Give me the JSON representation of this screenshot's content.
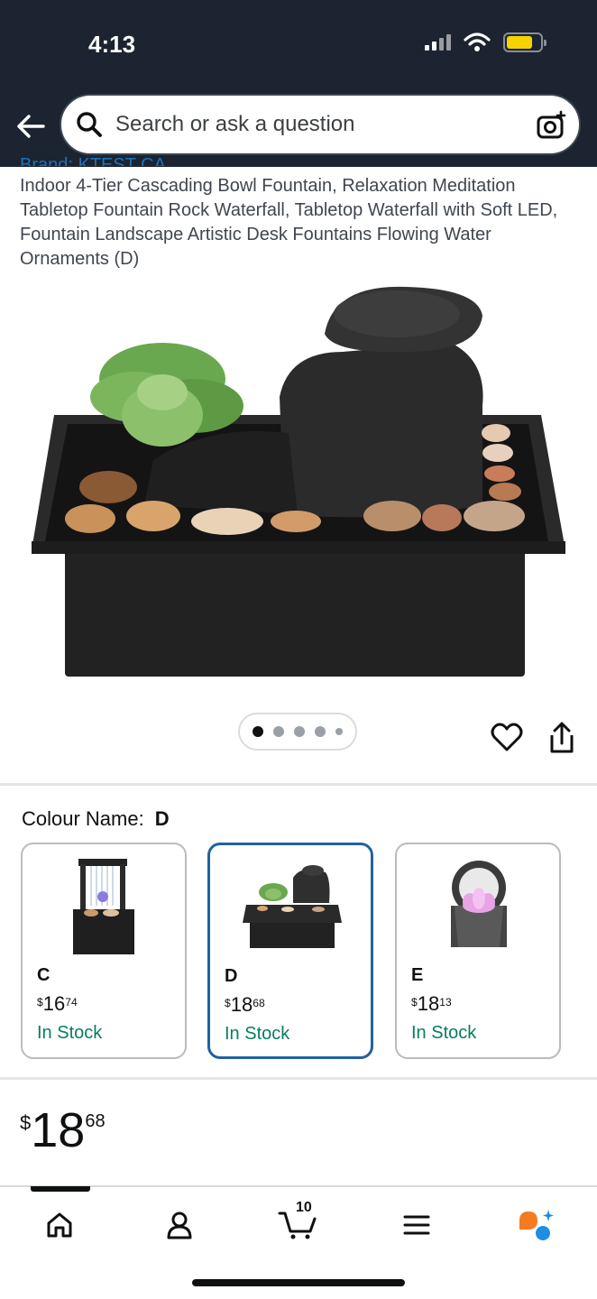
{
  "status_bar": {
    "time": "4:13"
  },
  "search": {
    "placeholder": "Search or ask a question"
  },
  "product": {
    "brand_partial": "Brand: KTEST CA",
    "title": "Indoor 4-Tier Cascading Bowl Fountain, Relaxation Meditation Tabletop Fountain Rock Waterfall, Tabletop Waterfall with Soft LED, Fountain Landscape Artistic Desk Fountains Flowing Water Ornaments (D)",
    "image_count": 5,
    "active_image": 1
  },
  "colour": {
    "label": "Colour Name:",
    "selected": "D",
    "options": [
      {
        "name": "C",
        "currency": "$",
        "dollars": "16",
        "cents": "74",
        "stock": "In Stock",
        "selected": false
      },
      {
        "name": "D",
        "currency": "$",
        "dollars": "18",
        "cents": "68",
        "stock": "In Stock",
        "selected": true
      },
      {
        "name": "E",
        "currency": "$",
        "dollars": "18",
        "cents": "13",
        "stock": "In Stock",
        "selected": false
      }
    ]
  },
  "price": {
    "currency": "$",
    "dollars": "18",
    "cents": "68"
  },
  "bottom_nav": {
    "cart_count": "10",
    "items": [
      "home-icon",
      "account-icon",
      "cart-icon",
      "menu-icon",
      "rufus-icon"
    ]
  },
  "colors": {
    "header_bg": "#1b2430",
    "in_stock": "#067d62",
    "selected_border": "#2162a1",
    "battery": "#f5d300"
  }
}
